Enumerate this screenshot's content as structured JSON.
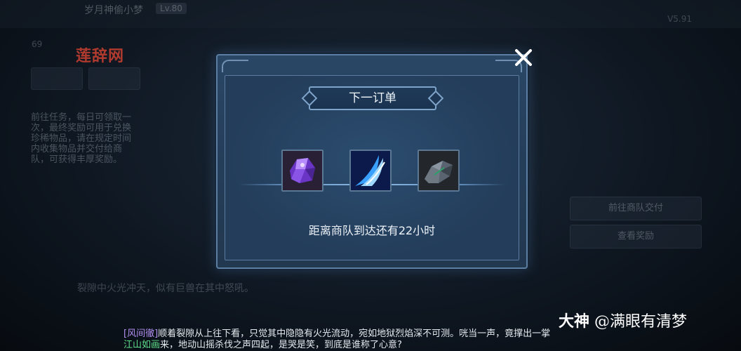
{
  "background": {
    "player_name": "岁月神偷小梦",
    "level_tag": "Lv.80",
    "level_num": "69",
    "version": "V5.91",
    "quest_text": "前往任务，每日可领取一次，最终奖励可用于兑换珍稀物品，请在规定时间内收集物品并交付给商队，可获得丰厚奖励。",
    "right_button_1": "前往商队交付",
    "right_button_2": "查看奖励",
    "blurred_line": "裂隙中火光冲天，似有巨兽在其中怒吼。"
  },
  "watermark": "莲辞网",
  "dialog": {
    "title": "下一订单",
    "countdown": "距离商队到达还有22小时",
    "items": [
      {
        "name": "purple-crystal",
        "color": "#8a4fe0"
      },
      {
        "name": "blue-blade-skill",
        "color": "#3aa0ff"
      },
      {
        "name": "dark-ore",
        "color": "#5a6470"
      }
    ]
  },
  "chat": {
    "line1_speaker": "[风间徹]",
    "line1_text": "顺着裂隙从上往下看，只觉其中隐隐有火光流动，宛如地狱烈焰深不可测。咣当一声，竟撑出一掌",
    "line2_speaker": "江山如画",
    "line2_text": "来，地动山摇杀伐之声四起，是哭是笑，到底是谁称了心意?"
  },
  "signature": {
    "brand": "大神",
    "handle": "@满眼有清梦"
  }
}
